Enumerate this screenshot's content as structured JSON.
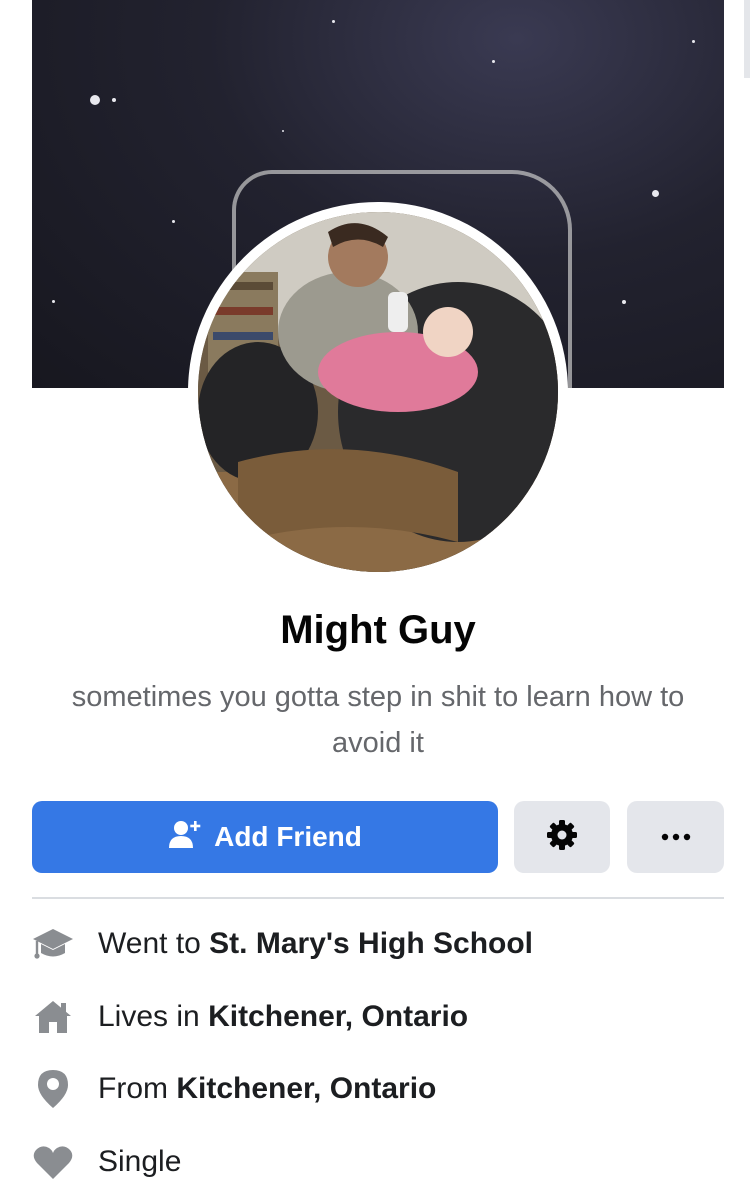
{
  "profile": {
    "name": "Might Guy",
    "bio": "sometimes you gotta step in shit to learn how to avoid it"
  },
  "actions": {
    "add_friend_label": "Add Friend",
    "add_friend_icon": "add-person-icon",
    "settings_icon": "gear-icon",
    "more_icon": "ellipsis-icon"
  },
  "intro": [
    {
      "icon": "graduation-cap-icon",
      "prefix": "Went to ",
      "value": "St. Mary's High School"
    },
    {
      "icon": "home-icon",
      "prefix": "Lives in ",
      "value": "Kitchener, Ontario"
    },
    {
      "icon": "location-pin-icon",
      "prefix": "From ",
      "value": "Kitchener, Ontario"
    },
    {
      "icon": "heart-icon",
      "prefix": "",
      "value": "Single"
    }
  ],
  "colors": {
    "primary": "#3578e5",
    "secondary_button": "#e4e6eb",
    "muted_text": "#65676b",
    "icon_gray": "#8a8d91"
  }
}
